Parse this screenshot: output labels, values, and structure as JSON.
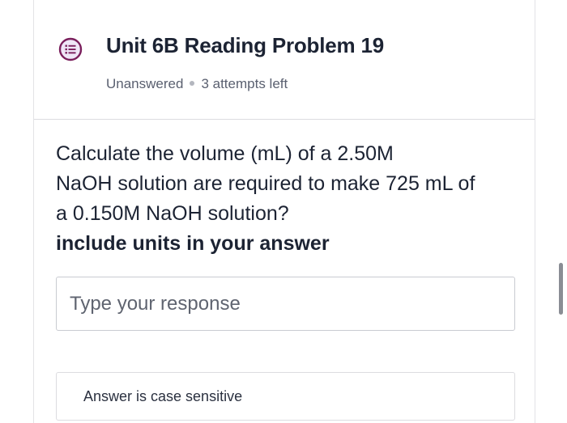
{
  "header": {
    "icon": "question-list-icon",
    "title": "Unit 6B Reading Problem 19",
    "status": "Unanswered",
    "attempts": "3 attempts left"
  },
  "question": {
    "lines": [
      "Calculate the volume (mL) of a 2.50M",
      "NaOH solution are required to make 725 mL of",
      "a 0.150M NaOH solution?"
    ],
    "instruction": "include units in your answer"
  },
  "response": {
    "placeholder": "Type your response",
    "value": ""
  },
  "note": {
    "text": "Answer is case sensitive"
  },
  "colors": {
    "icon_border": "#7a1f5c",
    "icon_bg": "#efe6f7",
    "text": "#1c2333",
    "muted": "#5a6070"
  }
}
